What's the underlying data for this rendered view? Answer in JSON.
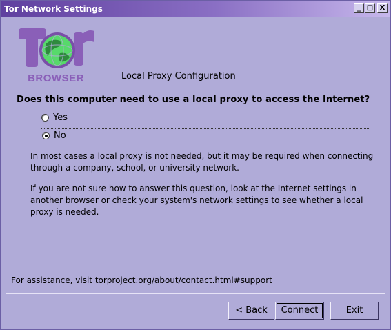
{
  "window": {
    "title": "Tor Network Settings",
    "controls": {
      "minimize": "_",
      "maximize": "□",
      "close": "X"
    }
  },
  "logo": {
    "text": "BROWSER",
    "icon": "tor-browser-logo"
  },
  "section_title": "Local Proxy Configuration",
  "question": "Does this computer need to use a local proxy to access the Internet?",
  "options": [
    {
      "label": "Yes",
      "selected": false
    },
    {
      "label": "No",
      "selected": true
    }
  ],
  "info": {
    "paragraph1": "In most cases a local proxy is not needed, but it may be required when connecting through a company, school, or university network.",
    "paragraph2": "If you are not sure how to answer this question, look at the Internet settings in another browser or check your system's network settings to see whether a local proxy is needed."
  },
  "assistance": "For assistance, visit torproject.org/about/contact.html#support",
  "buttons": {
    "back": "< Back",
    "connect": "Connect",
    "exit": "Exit"
  },
  "colors": {
    "window_bg": "#b0abd8",
    "titlebar": "#5f3f9f",
    "logo_globe": "#57d96b",
    "logo_purple": "#8a5fb8"
  }
}
